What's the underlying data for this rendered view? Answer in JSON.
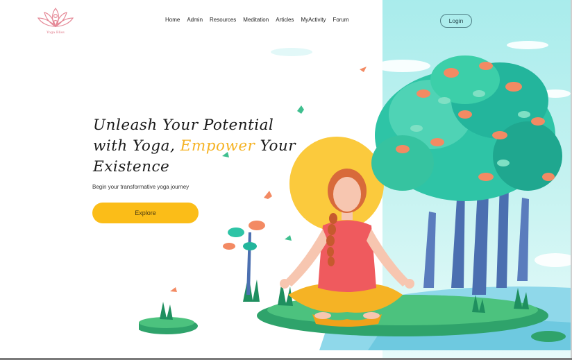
{
  "logo": {
    "text": "Yoga Bliss",
    "icon": "lotus-meditation-icon"
  },
  "nav": {
    "items": [
      {
        "label": "Home"
      },
      {
        "label": "Admin"
      },
      {
        "label": "Resources"
      },
      {
        "label": "Meditation"
      },
      {
        "label": "Articles"
      },
      {
        "label": "MyActivity"
      },
      {
        "label": "Forum"
      }
    ],
    "login_label": "Login"
  },
  "hero": {
    "line1": "Unleash Your Potential",
    "line2_prefix": "with Yoga, ",
    "line2_accent": "Empower",
    "line2_suffix": " Your",
    "line3": "Existence",
    "subtitle": "Begin your transformative yoga journey",
    "cta_label": "Explore"
  },
  "colors": {
    "accent": "#f5b325",
    "button": "#fbbd18",
    "sky": "#a9ecec",
    "logo": "#e07a8a"
  }
}
